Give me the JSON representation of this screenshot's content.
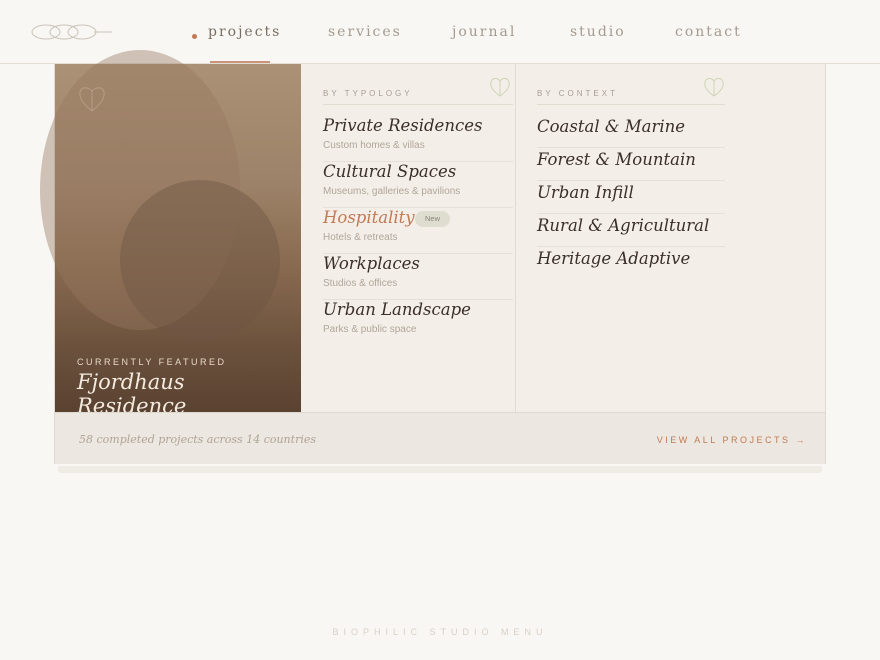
{
  "nav": {
    "items": [
      {
        "label": "projects"
      },
      {
        "label": "services"
      },
      {
        "label": "journal"
      },
      {
        "label": "studio"
      },
      {
        "label": "contact"
      }
    ]
  },
  "menu": {
    "featured": {
      "label": "CURRENTLY FEATURED",
      "title": "Fjordhaus Residence"
    },
    "typology": {
      "heading": "BY TYPOLOGY",
      "items": [
        {
          "title": "Private Residences",
          "subtitle": "Custom homes & villas"
        },
        {
          "title": "Cultural Spaces",
          "subtitle": "Museums, galleries & pavilions"
        },
        {
          "title": "Hospitality",
          "subtitle": "Hotels & retreats",
          "badge": "New"
        },
        {
          "title": "Workplaces",
          "subtitle": "Studios & offices"
        },
        {
          "title": "Urban Landscape",
          "subtitle": "Parks & public space"
        }
      ]
    },
    "context": {
      "heading": "BY CONTEXT",
      "items": [
        {
          "title": "Coastal & Marine"
        },
        {
          "title": "Forest & Mountain"
        },
        {
          "title": "Urban Infill"
        },
        {
          "title": "Rural & Agricultural"
        },
        {
          "title": "Heritage Adaptive"
        }
      ]
    },
    "footer": {
      "stats": "58 completed projects across 14 countries",
      "cta": "VIEW ALL PROJECTS →"
    }
  },
  "caption": "BIOPHILIC STUDIO MENU",
  "colors": {
    "accent": "#c27a55",
    "text": "#3a2f28",
    "muted": "#a79d92",
    "background": "#f9f7f3"
  }
}
